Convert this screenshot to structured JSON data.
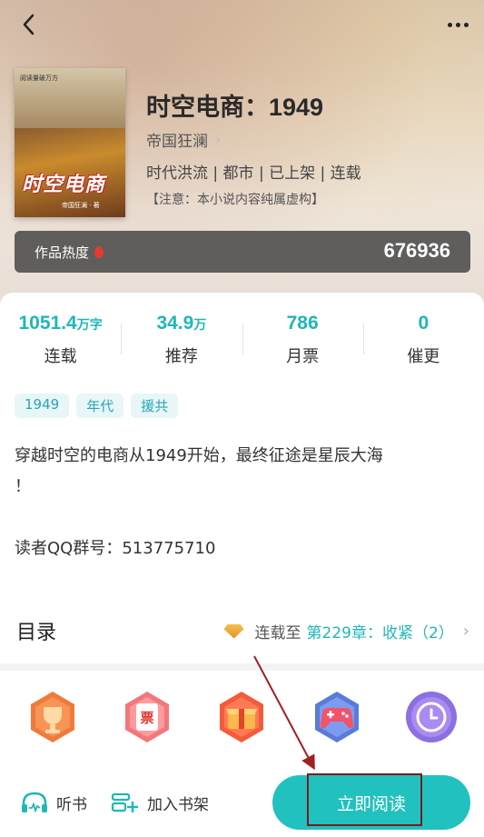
{
  "header": {
    "back_icon": "chevron-left-icon",
    "more_icon": "more-dots-icon"
  },
  "cover": {
    "top_text": "阅读量破万方",
    "title": "时空电商",
    "author_tag": "帝国狂澜 · 著"
  },
  "book": {
    "title": "时空电商：1949",
    "author": "帝国狂澜",
    "genre": "时代洪流 | 都市 | 已上架 | 连载",
    "notice": "【注意：本小说内容纯属虚构】"
  },
  "heat": {
    "label": "作品热度",
    "value": "676936",
    "icon": "flame-icon"
  },
  "stats": [
    {
      "value": "1051.4",
      "unit": "万字",
      "label": "连载"
    },
    {
      "value": "34.9",
      "unit": "万",
      "label": "推荐"
    },
    {
      "value": "786",
      "unit": "",
      "label": "月票"
    },
    {
      "value": "0",
      "unit": "",
      "label": "催更"
    }
  ],
  "tags": [
    "1949",
    "年代",
    "援共"
  ],
  "description": {
    "line1": "穿越时空的电商从1949开始，最终征途是星辰大海",
    "line2": "！",
    "line3": "",
    "line4": "读者QQ群号：513775710"
  },
  "toc": {
    "title": "目录",
    "prefix": "连载至",
    "chapter": "第229章：收紧（2）"
  },
  "icons": [
    "trophy-icon",
    "ticket-icon",
    "gift-box-icon",
    "gamepad-icon",
    "clock-icon"
  ],
  "bottom": {
    "listen": "听书",
    "shelf": "加入书架",
    "read": "立即阅读"
  },
  "colors": {
    "accent": "#21c1bf",
    "stat": "#1fb7b7",
    "tag_bg": "#e8f6f8",
    "heat_bg": "#464646"
  }
}
